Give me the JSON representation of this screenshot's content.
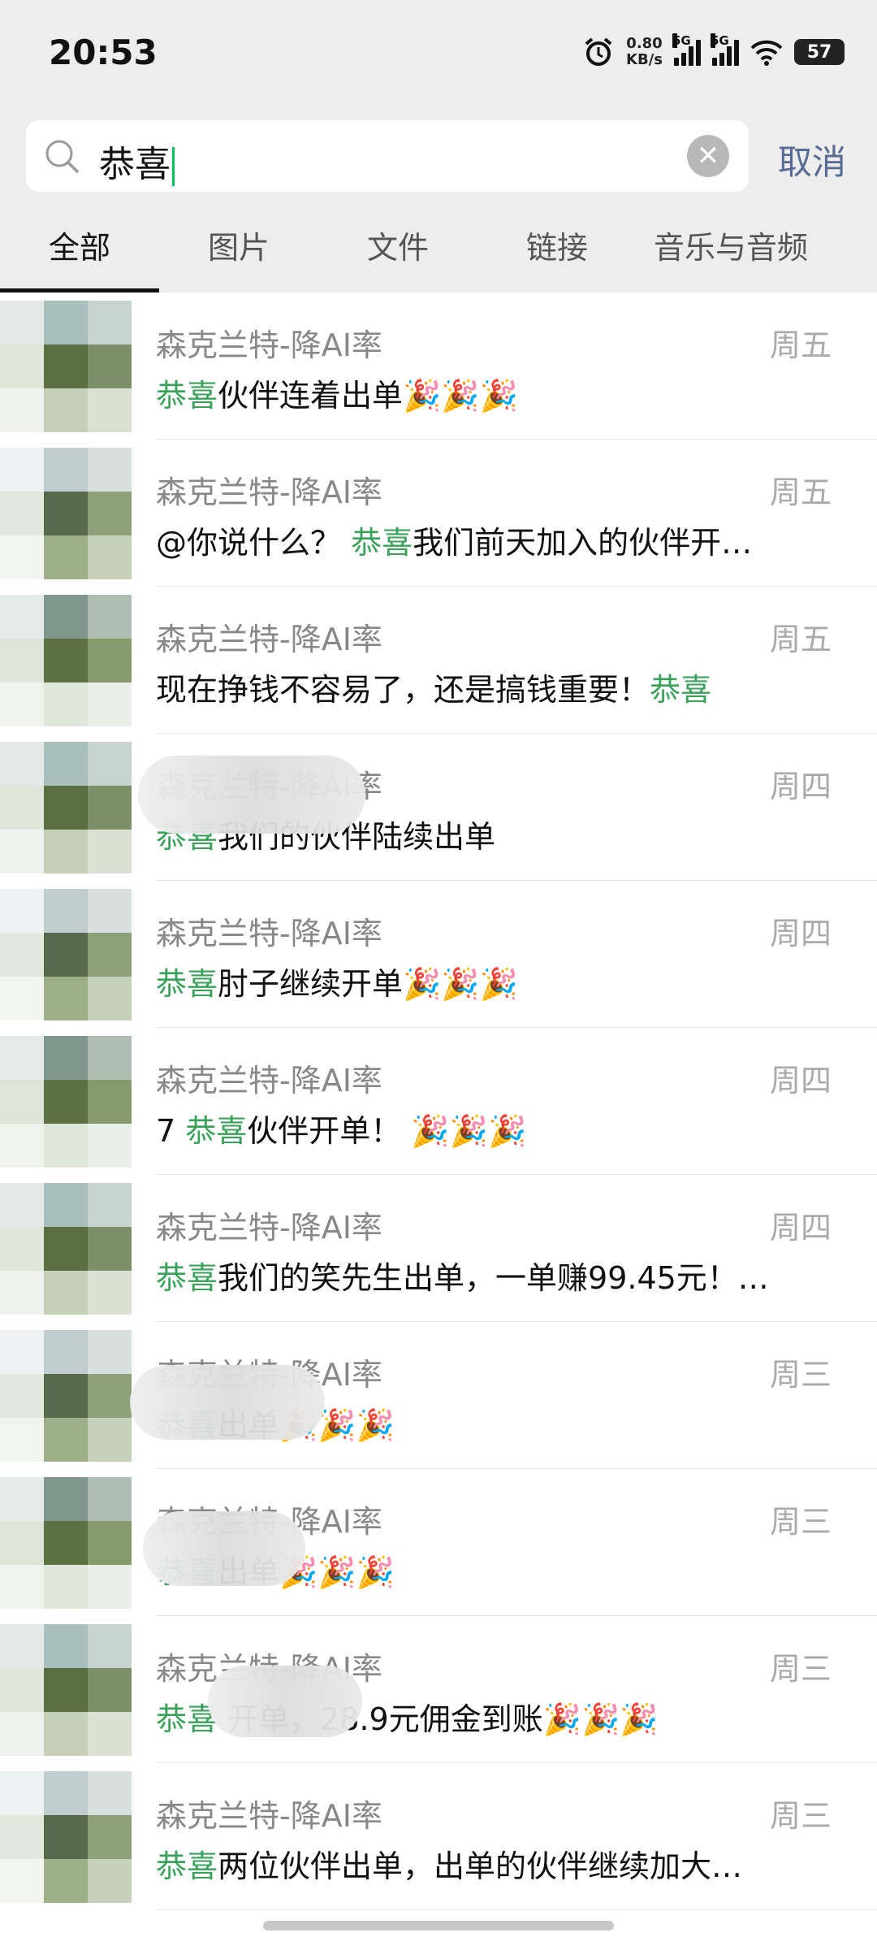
{
  "status_bar": {
    "time": "20:53",
    "net_speed": "0.80",
    "net_unit": "KB/s",
    "sim1": "5G",
    "sim2": "5G",
    "battery": "57"
  },
  "search": {
    "query": "恭喜",
    "cancel": "取消"
  },
  "tabs": [
    {
      "label": "全部",
      "active": true
    },
    {
      "label": "图片"
    },
    {
      "label": "文件"
    },
    {
      "label": "链接"
    },
    {
      "label": "音乐与音频"
    }
  ],
  "results": [
    {
      "name": "森克兰特-降AI率",
      "day": "周五",
      "before": "",
      "hl": "恭喜",
      "after": "伙伴连着出单🎉🎉🎉"
    },
    {
      "name": "森克兰特-降AI率",
      "day": "周五",
      "before": "@你说什么？ ",
      "hl": "恭喜",
      "after": "我们前天加入的伙伴开…"
    },
    {
      "name": "森克兰特-降AI率",
      "day": "周五",
      "before": "现在挣钱不容易了，还是搞钱重要！",
      "hl": "恭喜",
      "after": ""
    },
    {
      "name": "森克兰特-降AI率",
      "day": "周四",
      "before": "",
      "hl": "恭喜",
      "after": "我们的伙伴陆续出单"
    },
    {
      "name": "森克兰特-降AI率",
      "day": "周四",
      "before": "",
      "hl": "恭喜",
      "after": "肘子继续开单🎉🎉🎉"
    },
    {
      "name": "森克兰特-降AI率",
      "day": "周四",
      "before": "        7 ",
      "hl": "恭喜",
      "after": "伙伴开单！ 🎉🎉🎉"
    },
    {
      "name": "森克兰特-降AI率",
      "day": "周四",
      "before": "",
      "hl": "恭喜",
      "after": "我们的笑先生出单，一单赚99.45元！…"
    },
    {
      "name": "森克兰特-降AI率",
      "day": "周三",
      "before": "          ",
      "hl": "恭喜",
      "after": "出单🎉🎉🎉"
    },
    {
      "name": "森克兰特-降AI率",
      "day": "周三",
      "before": "          ",
      "hl": "恭喜",
      "after": "出单🎉🎉🎉"
    },
    {
      "name": "森克兰特-降AI率",
      "day": "周三",
      "before": "",
      "hl": "恭喜",
      "after": "        开单，28.9元佣金到账🎉🎉🎉"
    },
    {
      "name": "森克兰特-降AI率",
      "day": "周三",
      "before": "",
      "hl": "恭喜",
      "after": "两位伙伴出单，出单的伙伴继续加大…"
    }
  ],
  "colors": {
    "highlight": "#3aa15a",
    "cancel": "#576b95",
    "caret": "#07c160"
  }
}
